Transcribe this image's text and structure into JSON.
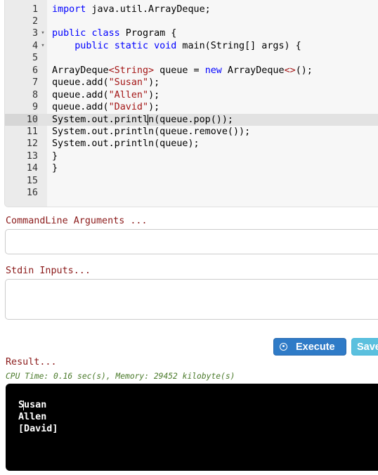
{
  "editor": {
    "lines": [
      {
        "n": "1",
        "fold": "",
        "html": "<span class='kw'>import</span> java.util.ArrayDeque;"
      },
      {
        "n": "2",
        "fold": "",
        "html": ""
      },
      {
        "n": "3",
        "fold": "▾",
        "html": "<span class='kw'>public</span> <span class='kw'>class</span> Program {"
      },
      {
        "n": "4",
        "fold": "▾",
        "html": "    <span class='kw'>public</span> <span class='kw'>static</span> <span class='kw'>void</span> main(String[] args) {"
      },
      {
        "n": "5",
        "fold": "",
        "html": ""
      },
      {
        "n": "6",
        "fold": "",
        "html": "ArrayDeque<span class='gen'>&lt;String&gt;</span> queue = <span class='kw'>new</span> ArrayDeque<span class='gen'>&lt;&gt;</span>();"
      },
      {
        "n": "7",
        "fold": "",
        "html": "queue.add(<span class='str'>\"Susan\"</span>);"
      },
      {
        "n": "8",
        "fold": "",
        "html": "queue.add(<span class='str'>\"Allen\"</span>);"
      },
      {
        "n": "9",
        "fold": "",
        "html": "queue.add(<span class='str'>\"David\"</span>);"
      },
      {
        "n": "10",
        "fold": "",
        "html": "System.out.printl<span class='cursor'></span>n(queue.pop());",
        "active": true
      },
      {
        "n": "11",
        "fold": "",
        "html": "System.out.println(queue.remove());"
      },
      {
        "n": "12",
        "fold": "",
        "html": "System.out.println(queue);"
      },
      {
        "n": "13",
        "fold": "",
        "html": "}"
      },
      {
        "n": "14",
        "fold": "",
        "html": "}"
      },
      {
        "n": "15",
        "fold": "",
        "html": ""
      },
      {
        "n": "16",
        "fold": "",
        "html": ""
      }
    ]
  },
  "cmdline": {
    "label": "CommandLine Arguments ...",
    "value": ""
  },
  "stdin": {
    "label": "Stdin Inputs...",
    "value": ""
  },
  "buttons": {
    "execute": "Execute",
    "save": "Save"
  },
  "result": {
    "label": "Result...",
    "stats": "CPU Time: 0.16 sec(s), Memory: 29452 kilobyte(s)",
    "output": [
      "Susan",
      "Allen",
      "[David]"
    ]
  },
  "icons": {
    "execute": "play-circle-icon",
    "fold": "fold-arrow-icon"
  },
  "colors": {
    "label": "#8b1a1a",
    "keyword": "#0000ff",
    "string": "#a31515",
    "execute": "#2f7bc7",
    "save": "#5bc0de",
    "console": "#000000"
  }
}
